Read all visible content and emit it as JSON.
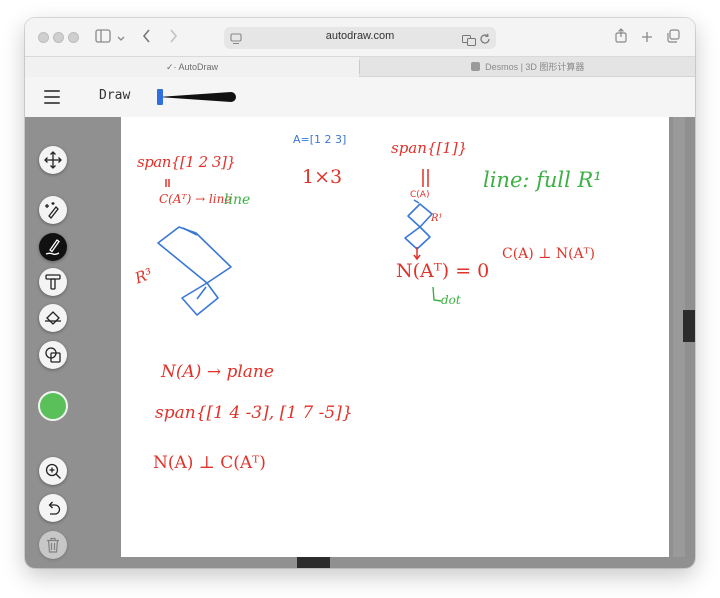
{
  "browser": {
    "url": "autodraw.com",
    "tabs": [
      {
        "label": "✓· AutoDraw",
        "active": true
      },
      {
        "label": "Desmos | 3D 图形计算器",
        "active": false
      }
    ]
  },
  "app": {
    "mode_label": "Draw"
  },
  "toolbar": {
    "tools": [
      {
        "name": "move-icon",
        "active": false
      },
      {
        "name": "autodraw-icon",
        "active": false
      },
      {
        "name": "draw-icon",
        "active": true
      },
      {
        "name": "type-icon",
        "active": false
      },
      {
        "name": "fill-icon",
        "active": false
      },
      {
        "name": "shape-icon",
        "active": false
      }
    ],
    "selected_color": "#5ac05a",
    "bottom_tools": [
      "zoom-in-icon",
      "undo-icon",
      "delete-icon"
    ]
  },
  "canvas": {
    "annotations": {
      "span_col": "span{[1 2 3]}",
      "arrow_down": "||",
      "col_space": "C(Aᵀ) → line",
      "r3": "R³",
      "matrix_a": "A=[1 2 3]",
      "dims": "1×3",
      "span_row": "span{[1]}",
      "ca_label": "C(A)",
      "r1_label": "R¹",
      "line_full": "line: full R¹",
      "null_at": "N(Aᵀ) = 0",
      "dot": "dot",
      "ca_perp": "C(A) ⊥ N(Aᵀ)",
      "null_a": "N(A) → plane",
      "span_null": "span{[1 4 -3], [1 7 -5]}",
      "na_perp": "N(A) ⊥ C(Aᵀ)"
    },
    "colors": {
      "red": "#e0322a",
      "green": "#3cb043",
      "blue": "#3a78d6",
      "purple": "#9b30d9"
    }
  }
}
